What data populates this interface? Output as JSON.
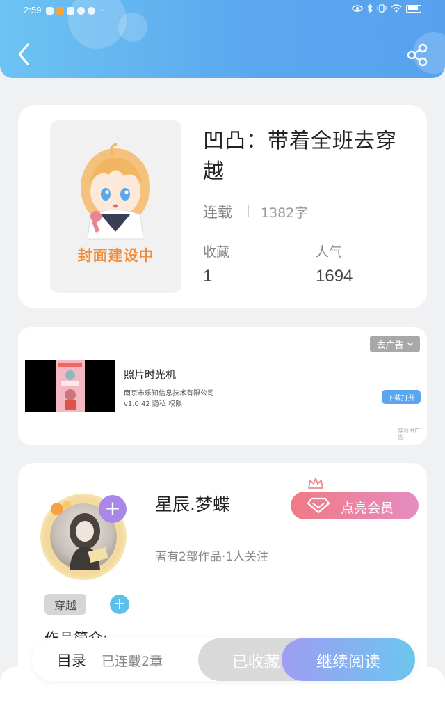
{
  "status_bar": {
    "time": "2:59",
    "more": "···"
  },
  "header": {
    "back_icon": "chevron-left-icon",
    "share_icon": "share-icon",
    "color": "#5aa6ef"
  },
  "book": {
    "cover_label": "封面建设中",
    "title": "凹凸：带着全班去穿越",
    "status": "连载",
    "word_count": "1382字",
    "stats": [
      {
        "label": "收藏",
        "value": "1"
      },
      {
        "label": "人气",
        "value": "1694"
      }
    ]
  },
  "ad": {
    "remove_label": "去广告",
    "title": "照片时光机",
    "company": "南京市乐知信息技术有限公司",
    "meta": "v1.0.42  隐私  权限",
    "download_label": "下载打开",
    "source": "穿山甲广告"
  },
  "author": {
    "name": "星辰.梦蝶",
    "add_icon": "+",
    "vip_label": "点亮会员",
    "meta": "著有2部作品·1人关注",
    "tag": "穿越",
    "add_tag_icon": "+",
    "intro_heading": "作品简介:"
  },
  "bottom_bar": {
    "toc_label": "目录",
    "chapter_count": "已连载2章",
    "collected_label": "已收藏",
    "continue_label": "继续阅读"
  }
}
